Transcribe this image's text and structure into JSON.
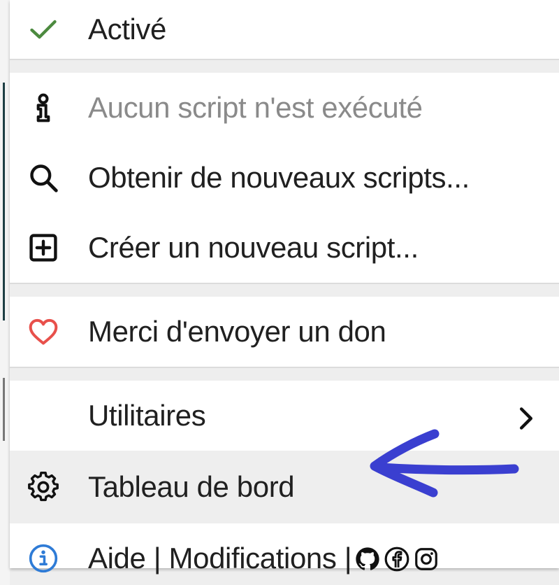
{
  "menu": {
    "enabled_label": "Activé",
    "no_script_label": "Aucun script n'est exécuté",
    "get_scripts_label": "Obtenir de nouveaux scripts...",
    "create_script_label": "Créer un nouveau script...",
    "donate_label": "Merci d'envoyer un don",
    "utilities_label": "Utilitaires",
    "dashboard_label": "Tableau de bord",
    "help_label": "Aide",
    "separator": "|",
    "changes_label": "Modifications"
  },
  "icons": {
    "enabled": "check-icon",
    "no_script": "info-outline-icon",
    "get_scripts": "search-icon",
    "create_script": "plus-square-icon",
    "donate": "heart-icon",
    "utilities": "chevron-right-icon",
    "dashboard": "gear-icon",
    "help": "info-circle-icon",
    "github": "github-icon",
    "facebook": "facebook-icon",
    "instagram": "instagram-icon"
  },
  "colors": {
    "check": "#4c8a3f",
    "heart": "#e8504b",
    "info": "#2e7bd6",
    "annotation_arrow": "#3a3fd0",
    "disabled_text": "#8a8a8a",
    "highlight_bg": "#eeeeee"
  }
}
